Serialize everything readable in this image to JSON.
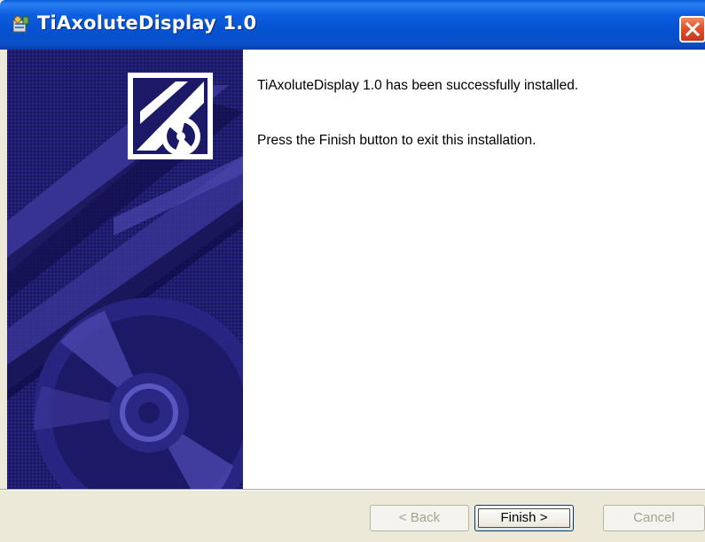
{
  "window": {
    "title": "TiAxoluteDisplay 1.0",
    "title_icon": "installer-icon",
    "close_icon": "close-icon"
  },
  "content": {
    "line1": "TiAxoluteDisplay 1.0 has been successfully installed.",
    "line2": "Press the Finish button to exit this installation."
  },
  "buttons": {
    "back": {
      "label": "< Back",
      "enabled": false
    },
    "finish": {
      "label": "Finish >",
      "enabled": true,
      "focused": true
    },
    "cancel": {
      "label": "Cancel",
      "enabled": false
    }
  },
  "colors": {
    "titlebar": "#0552d1",
    "banner": "#1c1a66",
    "dialog_face": "#ece9d8",
    "close_button": "#e0512e"
  }
}
